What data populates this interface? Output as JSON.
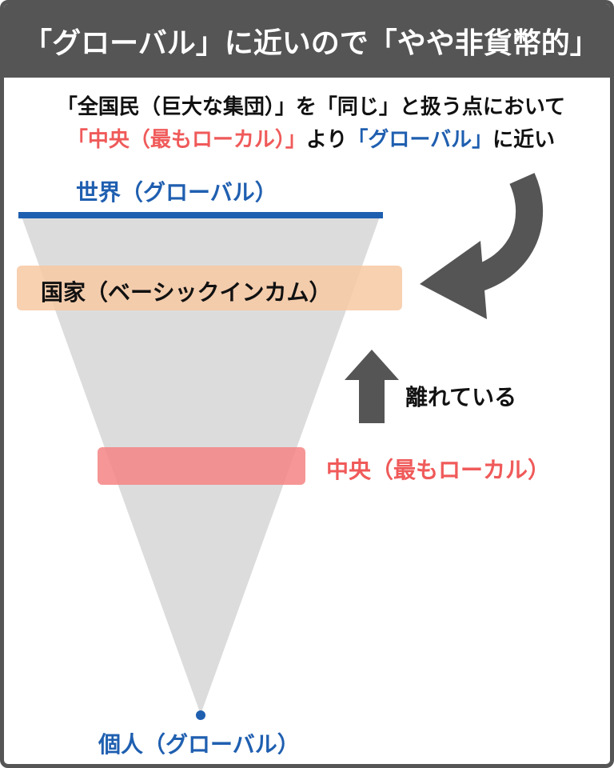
{
  "header": {
    "title": "「グローバル」に近いので「やや非貨幣的」"
  },
  "intro": {
    "line1": "「全国民（巨大な集団）」を「同じ」と扱う点において",
    "line2_red": "「中央（最もローカル）」",
    "line2_mid": "より",
    "line2_blue": "「グローバル」",
    "line2_end": "に近い"
  },
  "diagram": {
    "top_label": "世界（グローバル）",
    "band_nation_label": "国家（ベーシックインカム）",
    "moving_away_label": "離れている",
    "band_center_label": "中央（最もローカル）",
    "bottom_label": "個人（グローバル）"
  },
  "colors": {
    "header_bg": "#555555",
    "blue": "#1f5fb0",
    "red": "#f05a5a",
    "triangle": "#dcdcdc",
    "nation_band": "#f7c9a3",
    "center_band": "#f58484",
    "arrow": "#555555"
  }
}
